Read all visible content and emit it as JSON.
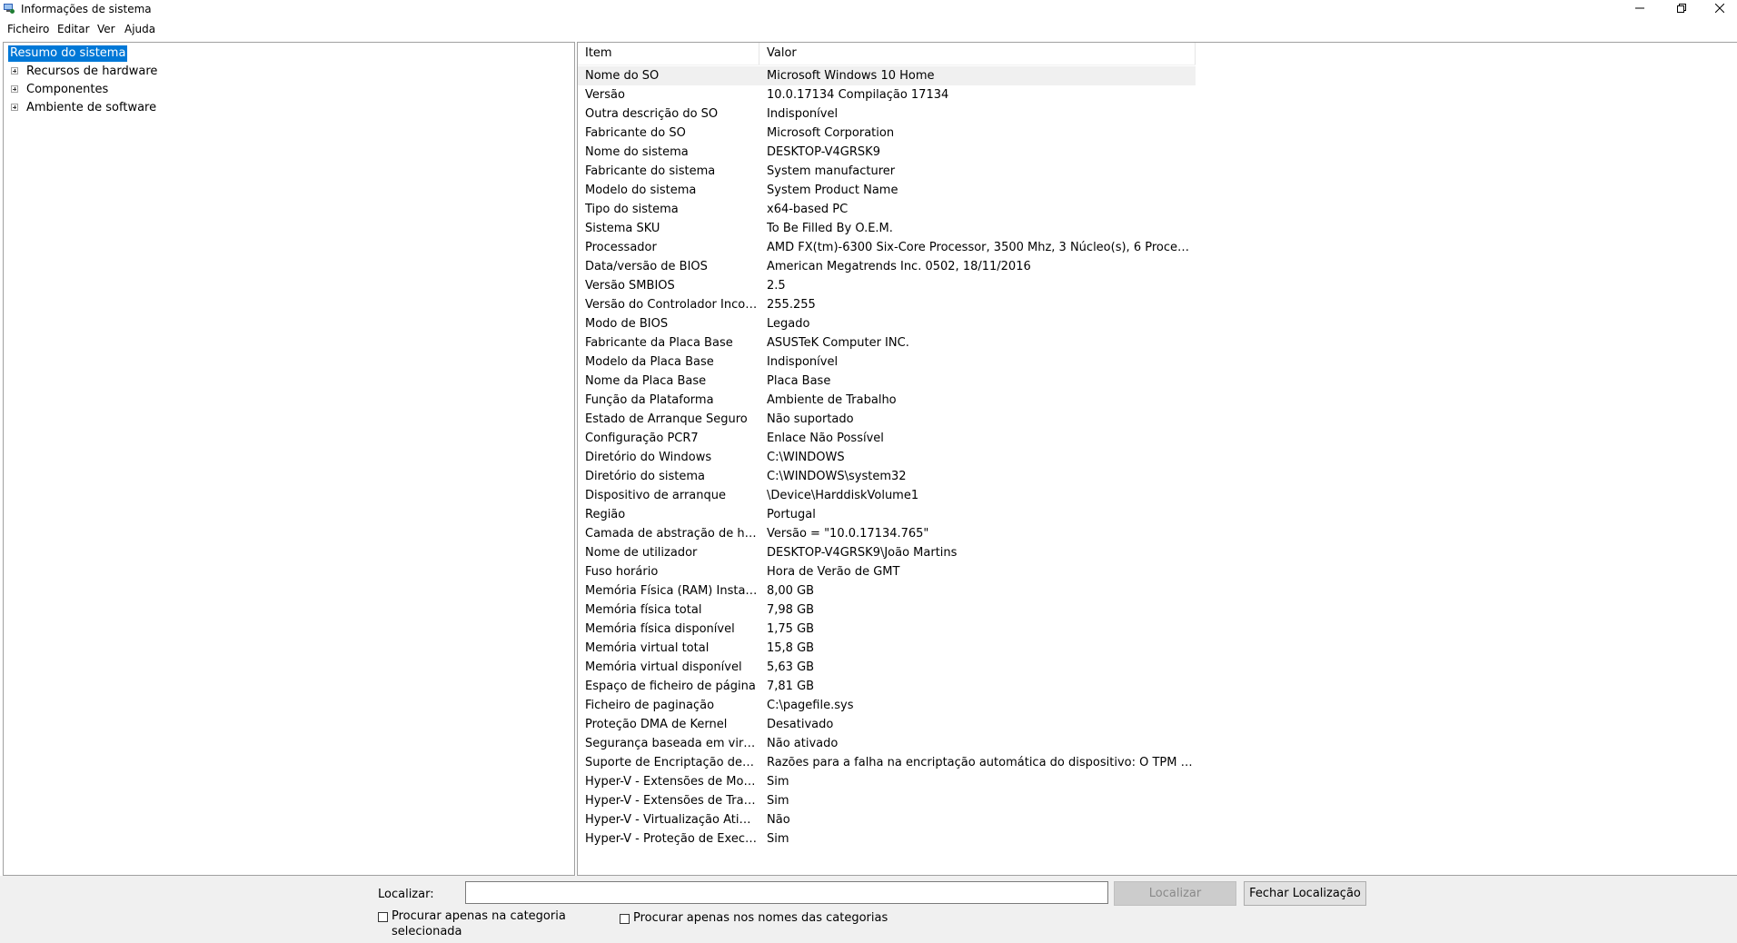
{
  "window": {
    "title": "Informações de sistema"
  },
  "menu": [
    "Ficheiro",
    "Editar",
    "Ver",
    "Ajuda"
  ],
  "tree": [
    {
      "label": "Resumo do sistema",
      "selected": true,
      "expandable": false
    },
    {
      "label": "Recursos de hardware",
      "selected": false,
      "expandable": true
    },
    {
      "label": "Componentes",
      "selected": false,
      "expandable": true
    },
    {
      "label": "Ambiente de software",
      "selected": false,
      "expandable": true
    }
  ],
  "list": {
    "columns": {
      "item": "Item",
      "valor": "Valor"
    },
    "rows": [
      {
        "item": "Nome do SO",
        "valor": "Microsoft Windows 10 Home"
      },
      {
        "item": "Versão",
        "valor": "10.0.17134 Compilação 17134"
      },
      {
        "item": "Outra descrição do SO",
        "valor": "Indisponível"
      },
      {
        "item": "Fabricante do SO",
        "valor": "Microsoft Corporation"
      },
      {
        "item": "Nome do sistema",
        "valor": "DESKTOP-V4GRSK9"
      },
      {
        "item": "Fabricante do sistema",
        "valor": "System manufacturer"
      },
      {
        "item": "Modelo do sistema",
        "valor": "System Product Name"
      },
      {
        "item": "Tipo do sistema",
        "valor": "x64-based PC"
      },
      {
        "item": "Sistema SKU",
        "valor": "To Be Filled By O.E.M."
      },
      {
        "item": "Processador",
        "valor": "AMD FX(tm)-6300 Six-Core Processor, 3500 Mhz, 3 Núcleo(s), 6 Processador(..."
      },
      {
        "item": "Data/versão de BIOS",
        "valor": "American Megatrends Inc. 0502, 18/11/2016"
      },
      {
        "item": "Versão SMBIOS",
        "valor": "2.5"
      },
      {
        "item": "Versão do Controlador Incorp...",
        "valor": "255.255"
      },
      {
        "item": "Modo de BIOS",
        "valor": "Legado"
      },
      {
        "item": "Fabricante da Placa Base",
        "valor": "ASUSTeK Computer INC."
      },
      {
        "item": "Modelo da Placa Base",
        "valor": "Indisponível"
      },
      {
        "item": "Nome da Placa Base",
        "valor": "Placa Base"
      },
      {
        "item": "Função da Plataforma",
        "valor": "Ambiente de Trabalho"
      },
      {
        "item": "Estado de Arranque Seguro",
        "valor": "Não suportado"
      },
      {
        "item": "Configuração PCR7",
        "valor": "Enlace Não Possível"
      },
      {
        "item": "Diretório do Windows",
        "valor": "C:\\WINDOWS"
      },
      {
        "item": "Diretório do sistema",
        "valor": "C:\\WINDOWS\\system32"
      },
      {
        "item": "Dispositivo de arranque",
        "valor": "\\Device\\HarddiskVolume1"
      },
      {
        "item": "Região",
        "valor": "Portugal"
      },
      {
        "item": "Camada de abstração de hard...",
        "valor": "Versão = \"10.0.17134.765\""
      },
      {
        "item": "Nome de utilizador",
        "valor": "DESKTOP-V4GRSK9\\João Martins"
      },
      {
        "item": "Fuso horário",
        "valor": "Hora de Verão de GMT"
      },
      {
        "item": "Memória Física (RAM) Instalada",
        "valor": "8,00 GB"
      },
      {
        "item": "Memória física total",
        "valor": "7,98 GB"
      },
      {
        "item": "Memória física disponível",
        "valor": "1,75 GB"
      },
      {
        "item": "Memória virtual total",
        "valor": "15,8 GB"
      },
      {
        "item": "Memória virtual disponível",
        "valor": "5,63 GB"
      },
      {
        "item": "Espaço de ficheiro de página",
        "valor": "7,81 GB"
      },
      {
        "item": "Ficheiro de paginação",
        "valor": "C:\\pagefile.sys"
      },
      {
        "item": "Proteção DMA de Kernel",
        "valor": "Desativado"
      },
      {
        "item": "Segurança baseada em virtuali...",
        "valor": "Não ativado"
      },
      {
        "item": "Suporte de Encriptação de Dis...",
        "valor": "Razões para a falha na encriptação automática do dispositivo: O TPM não é ..."
      },
      {
        "item": "Hyper-V - Extensões de Modo ...",
        "valor": "Sim"
      },
      {
        "item": "Hyper-V - Extensões de Traduç...",
        "valor": "Sim"
      },
      {
        "item": "Hyper-V - Virtualização Ativada...",
        "valor": "Não"
      },
      {
        "item": "Hyper-V - Proteção de Execuçã...",
        "valor": "Sim"
      }
    ]
  },
  "find": {
    "label": "Localizar:",
    "input_value": "",
    "find_button": "Localizar",
    "close_button": "Fechar Localização",
    "checkbox_selected_category": "Procurar apenas na categoria selecionada",
    "checkbox_category_names": "Procurar apenas nos nomes das categorias"
  },
  "colors": {
    "selection": "#0078d7",
    "find_bar": "#f0f0f0",
    "border": "#a0a0a0"
  }
}
